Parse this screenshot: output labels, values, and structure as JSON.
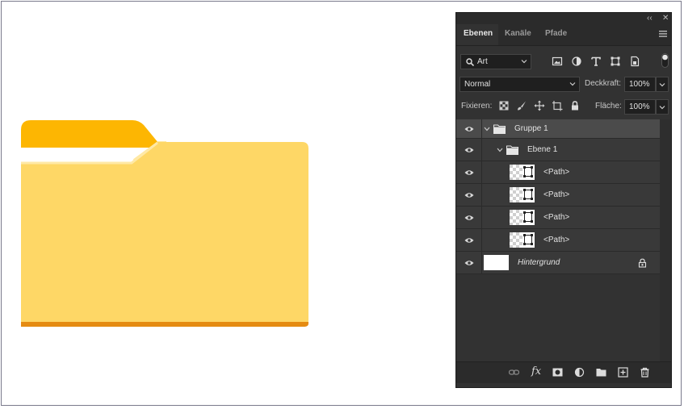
{
  "panel": {
    "top_controls": {
      "collapse": "‹‹",
      "close": "✕"
    },
    "tabs": [
      {
        "label": "Ebenen",
        "active": true
      },
      {
        "label": "Kanäle",
        "active": false
      },
      {
        "label": "Pfade",
        "active": false
      }
    ],
    "filter": {
      "label": "Art",
      "icons": [
        "image-filter-icon",
        "adjustment-filter-icon",
        "type-filter-icon",
        "shape-filter-icon",
        "smart-object-filter-icon"
      ]
    },
    "blend_mode": {
      "value": "Normal"
    },
    "opacity": {
      "label": "Deckkraft:",
      "value": "100%"
    },
    "lock": {
      "label": "Fixieren:",
      "icons": [
        "lock-transparency-icon",
        "lock-pixels-icon",
        "lock-position-icon",
        "lock-artboard-icon",
        "lock-all-icon"
      ]
    },
    "fill": {
      "label": "Fläche:",
      "value": "100%"
    },
    "layers": [
      {
        "name": "Gruppe 1",
        "type": "group",
        "selected": true
      },
      {
        "name": "Ebene 1",
        "type": "group",
        "selected": false
      },
      {
        "name": "<Path>",
        "type": "path",
        "selected": false
      },
      {
        "name": "<Path>",
        "type": "path",
        "selected": false
      },
      {
        "name": "<Path>",
        "type": "path",
        "selected": false
      },
      {
        "name": "<Path>",
        "type": "path",
        "selected": false
      },
      {
        "name": "Hintergrund",
        "type": "background",
        "selected": false,
        "locked": true
      }
    ],
    "bottom_icons": [
      "link-layers-icon",
      "fx-icon",
      "layer-mask-icon",
      "adjustment-layer-icon",
      "new-group-icon",
      "new-layer-icon",
      "delete-layer-icon"
    ]
  },
  "colors": {
    "folder_tab": "#FDB602",
    "folder_body": "#FED766",
    "folder_edge": "#E58B12",
    "panel_bg": "#323232"
  }
}
